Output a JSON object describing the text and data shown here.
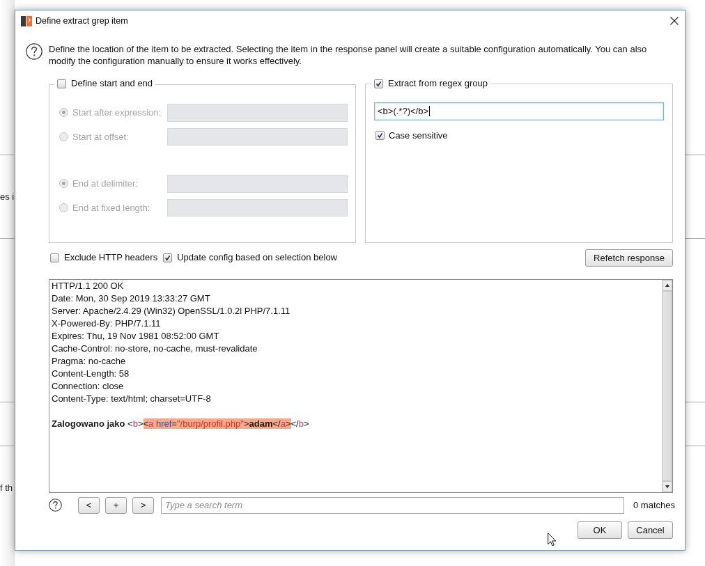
{
  "window": {
    "title": "Define extract grep item"
  },
  "background": {
    "fragments": [
      "es i",
      "f th"
    ]
  },
  "help_text": "Define the location of the item to be extracted. Selecting the item in the response panel will create a suitable configuration automatically. You can also modify the configuration manually to ensure it works effectively.",
  "start_end": {
    "label": "Define start and end",
    "checked": false,
    "start_options": [
      {
        "label": "Start after expression:",
        "selected": true,
        "disabled": true
      },
      {
        "label": "Start at offset:",
        "selected": false,
        "disabled": true
      }
    ],
    "end_options": [
      {
        "label": "End at delimiter:",
        "selected": true,
        "disabled": true
      },
      {
        "label": "End at fixed length:",
        "selected": false,
        "disabled": true
      }
    ]
  },
  "regex_group": {
    "label": "Extract from regex group",
    "checked": true,
    "value": "<b>(.*?)</b>",
    "case_sensitive": {
      "label": "Case sensitive",
      "checked": true
    }
  },
  "options": [
    {
      "label": "Exclude HTTP headers",
      "checked": false
    },
    {
      "label": "Update config based on selection below",
      "checked": true
    }
  ],
  "refetch_button": "Refetch response",
  "response": {
    "headers": [
      "HTTP/1.1 200 OK",
      "Date: Mon, 30 Sep 2019 13:33:27 GMT",
      "Server: Apache/2.4.29 (Win32) OpenSSL/1.0.2l PHP/7.1.11",
      "X-Powered-By: PHP/7.1.11",
      "Expires: Thu, 19 Nov 1981 08:52:00 GMT",
      "Cache-Control: no-store, no-cache, must-revalidate",
      "Pragma: no-cache",
      "Content-Length: 58",
      "Connection: close",
      "Content-Type: text/html; charset=UTF-8"
    ],
    "body": [
      {
        "selected": false,
        "tokens": [
          {
            "text": "Zalogowano jako",
            "kind": "bold"
          },
          {
            "text": " <",
            "kind": "punct"
          },
          {
            "text": "b",
            "kind": "tag"
          },
          {
            "text": ">",
            "kind": "punct"
          }
        ]
      },
      {
        "selected": true,
        "tokens": [
          {
            "text": "<",
            "kind": "punct"
          },
          {
            "text": "a",
            "kind": "tag"
          },
          {
            "text": " href",
            "kind": "attr"
          },
          {
            "text": "=",
            "kind": "punct"
          },
          {
            "text": "\"/burp/profil.php\"",
            "kind": "value"
          },
          {
            "text": ">",
            "kind": "punct"
          },
          {
            "text": "adam",
            "kind": "bold"
          },
          {
            "text": "</",
            "kind": "punct"
          },
          {
            "text": "a",
            "kind": "tag"
          },
          {
            "text": ">",
            "kind": "punct"
          }
        ]
      },
      {
        "selected": false,
        "tokens": [
          {
            "text": "</",
            "kind": "punct"
          },
          {
            "text": "b",
            "kind": "tag"
          },
          {
            "text": ">",
            "kind": "punct"
          }
        ]
      }
    ]
  },
  "search": {
    "buttons": [
      "<",
      "+",
      ">"
    ],
    "placeholder": "Type a search term",
    "matches": "0 matches"
  },
  "buttons": [
    "OK",
    "Cancel"
  ]
}
